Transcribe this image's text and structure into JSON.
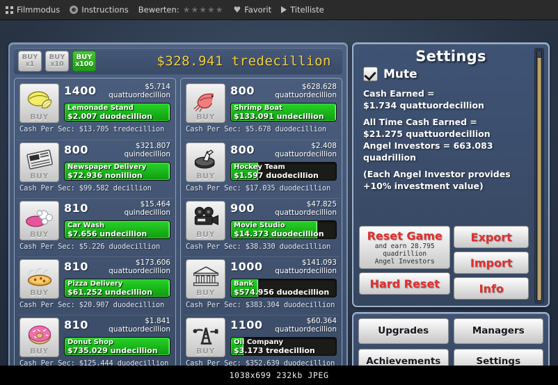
{
  "viewer": {
    "items": [
      {
        "icon": "grid-icon",
        "label": "Filmmodus"
      },
      {
        "icon": "circle-icon",
        "label": "Instructions"
      },
      {
        "icon": "none",
        "label": "Bewerten:"
      },
      {
        "icon": "heart-icon",
        "label": "Favorit"
      },
      {
        "icon": "play-icon",
        "label": "Titelliste"
      }
    ],
    "stars": "★★★★★"
  },
  "caption": "1038x699  232kb  JPEG",
  "game": {
    "header": {
      "buy_multipliers": [
        {
          "top": "BUY",
          "bottom": "x1",
          "name": "buy-x1",
          "active": false
        },
        {
          "top": "BUY",
          "bottom": "x10",
          "name": "buy-x10",
          "active": false
        },
        {
          "top": "BUY",
          "bottom": "x100",
          "name": "buy-x100",
          "active": true
        }
      ],
      "cash_total": "$328.941 tredecillion"
    },
    "businesses_left": [
      {
        "icon": "lemon-icon",
        "count": "1400",
        "price_amount": "$5.714",
        "price_unit": "quattuordecillion",
        "name": "Lemonade Stand",
        "revenue": "$2.007 duodecillion",
        "progress": 100,
        "cps": "Cash Per Sec: $13.705 tredecillion"
      },
      {
        "icon": "newspaper-icon",
        "count": "800",
        "price_amount": "$321.807",
        "price_unit": "quindecillion",
        "name": "Newspaper Delivery",
        "revenue": "$72.936 nonillion",
        "progress": 100,
        "cps": "Cash Per Sec: $99.582 decillion"
      },
      {
        "icon": "carwash-icon",
        "count": "810",
        "price_amount": "$15.464",
        "price_unit": "quindecillion",
        "name": "Car Wash",
        "revenue": "$7.656 undecillion",
        "progress": 100,
        "cps": "Cash Per Sec: $5.226 duodecillion"
      },
      {
        "icon": "pizza-icon",
        "count": "810",
        "price_amount": "$173.606",
        "price_unit": "quattuordecillion",
        "name": "Pizza Delivery",
        "revenue": "$61.252 undecillion",
        "progress": 100,
        "cps": "Cash Per Sec: $20.907 duodecillion"
      },
      {
        "icon": "donut-icon",
        "count": "810",
        "price_amount": "$1.841",
        "price_unit": "quattuordecillion",
        "name": "Donut Shop",
        "revenue": "$735.029 undecillion",
        "progress": 100,
        "cps": "Cash Per Sec: $125.444 duodecillion"
      }
    ],
    "businesses_right": [
      {
        "icon": "shrimp-icon",
        "count": "800",
        "price_amount": "$628.628",
        "price_unit": "quattuordecillion",
        "name": "Shrimp Boat",
        "revenue": "$133.091 undecillion",
        "progress": 100,
        "cps": "Cash Per Sec: $5.678 duodecillion"
      },
      {
        "icon": "hockey-icon",
        "count": "800",
        "price_amount": "$2.408",
        "price_unit": "quattuordecillion",
        "name": "Hockey Team",
        "revenue": "$1.597 duodecillion",
        "progress": 26,
        "cps": "Cash Per Sec: $17.035 duodecillion"
      },
      {
        "icon": "movie-camera-icon",
        "count": "900",
        "price_amount": "$47.825",
        "price_unit": "quattuordecillion",
        "name": "Movie Studio",
        "revenue": "$14.373 duodecillion",
        "progress": 82,
        "cps": "Cash Per Sec: $38.330 duodecillion"
      },
      {
        "icon": "bank-icon",
        "count": "1000",
        "price_amount": "$141.093",
        "price_unit": "quattuordecillion",
        "name": "Bank",
        "revenue": "$574.956 duodecillion",
        "progress": 26,
        "cps": "Cash Per Sec: $383.304 duodecillion"
      },
      {
        "icon": "oil-derrick-icon",
        "count": "1100",
        "price_amount": "$60.364",
        "price_unit": "quattuordecillion",
        "name": "Oil Company",
        "revenue": "$3.173 tredecillion",
        "progress": 12,
        "cps": "Cash Per Sec: $352.639 duodecillion"
      }
    ],
    "settings": {
      "title": "Settings",
      "mute_label": "Mute",
      "mute_checked": true,
      "lines": [
        "Cash Earned =",
        "$1.734 quattuordecillion",
        "All Time Cash Earned =",
        "$21.275 quattuordecillion",
        "Angel Investors = 663.083",
        "quadrillion",
        "(Each Angel Investor provides",
        "+10% investment value)"
      ],
      "reset_game_label": "Reset Game",
      "reset_game_sub_line1": "and earn 28.795",
      "reset_game_sub_line2": "quadrillion",
      "reset_game_sub_line3": "Angel Investors",
      "hard_reset_label": "Hard Reset",
      "export_label": "Export",
      "import_label": "Import",
      "info_label": "Info"
    },
    "nav": {
      "buttons": [
        "Upgrades",
        "Managers",
        "Achievements",
        "Settings"
      ]
    },
    "colors": {
      "accent_cash": "#f5cf3a",
      "progress_green": "#1fb81f",
      "buy_active_green": "#2aa81f",
      "danger_red": "#e03030",
      "panel_blue": "#3f5375"
    }
  }
}
